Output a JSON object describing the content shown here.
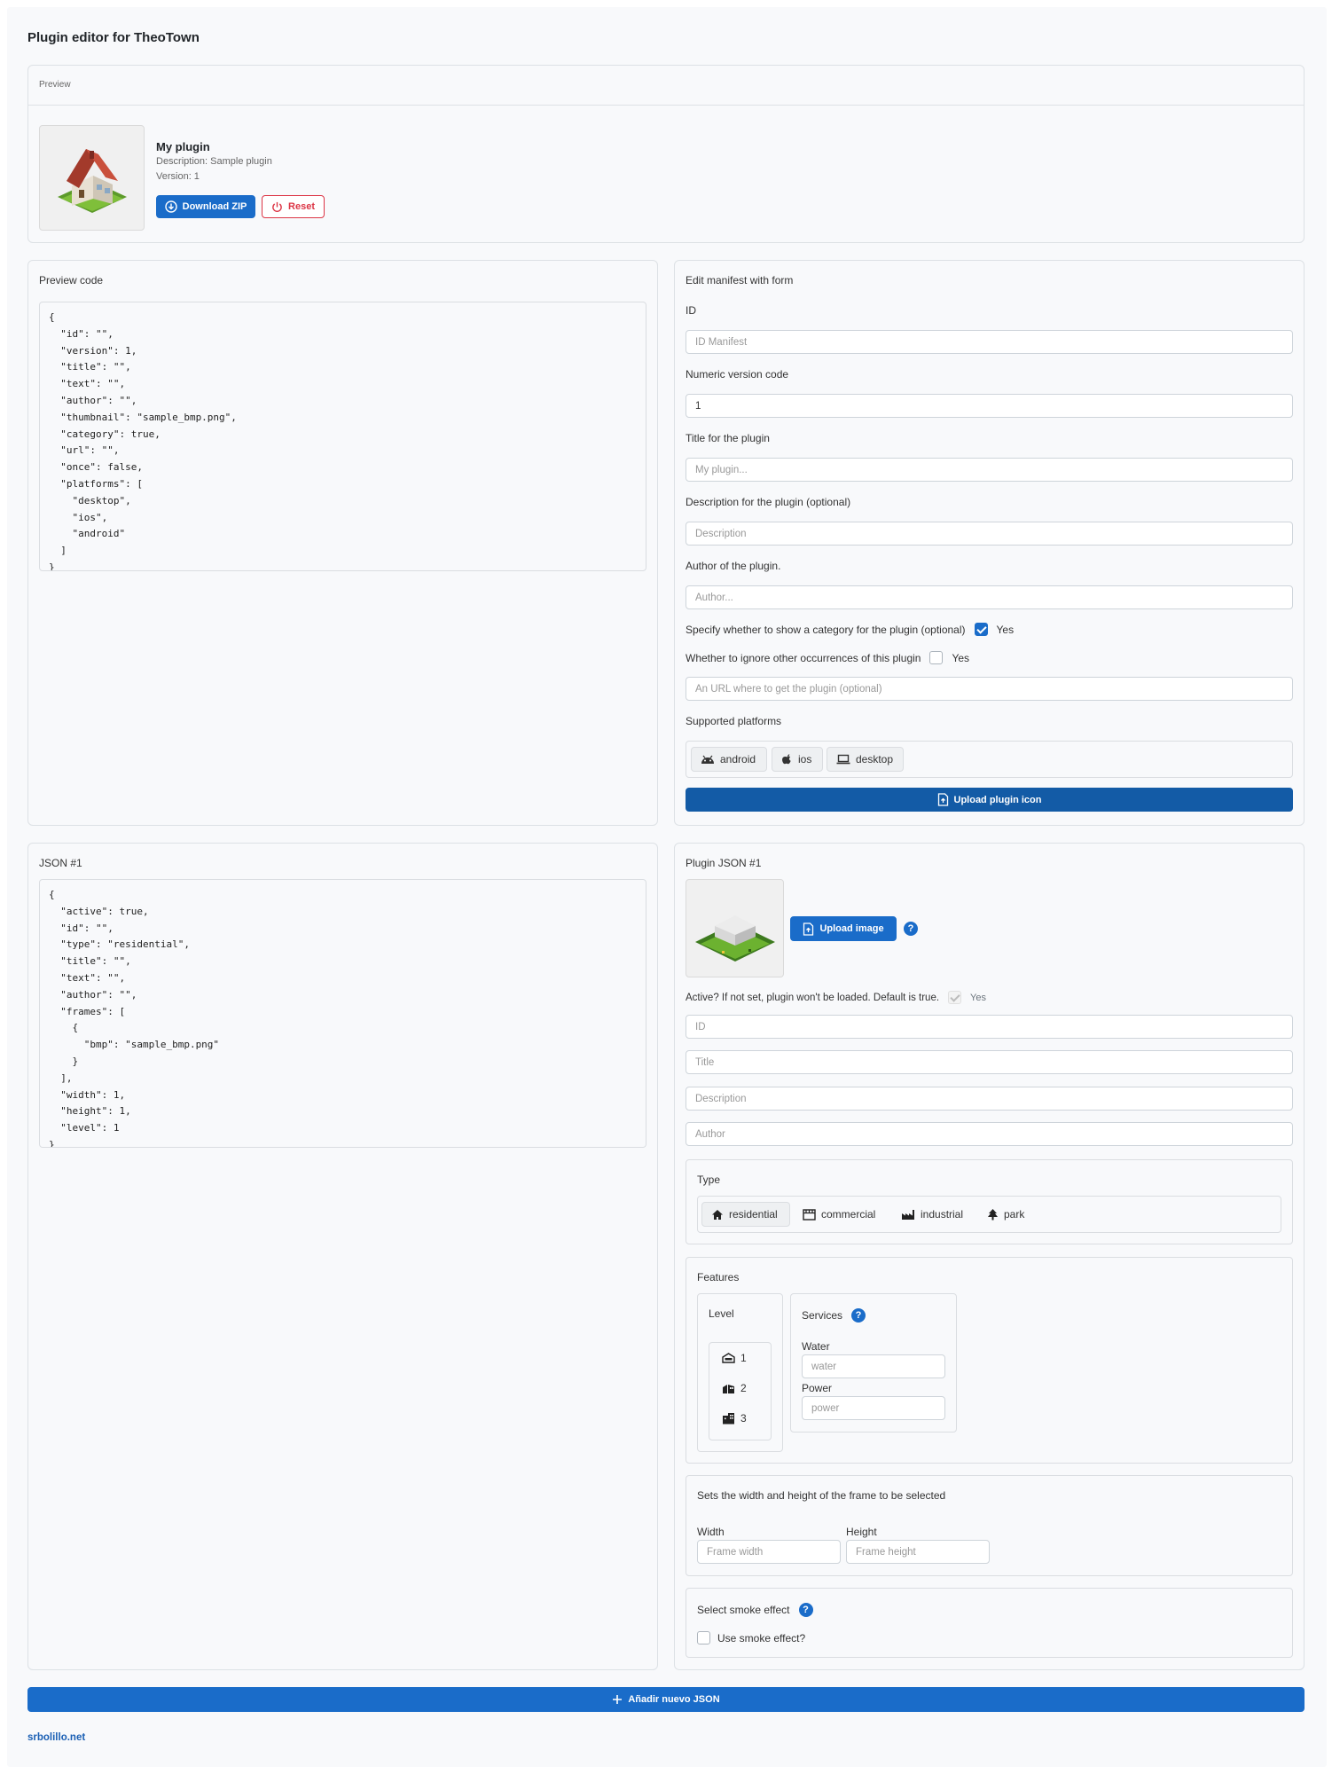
{
  "app": {
    "title": "Plugin editor for TheoTown",
    "footer": "srbolillo.net"
  },
  "preview": {
    "heading": "Preview",
    "plugin_title": "My plugin",
    "description": "Description: Sample plugin",
    "version": "Version: 1",
    "download_label": "Download ZIP",
    "reset_label": "Reset"
  },
  "preview_code": {
    "heading": "Preview code",
    "code": "{\n  \"id\": \"\",\n  \"version\": 1,\n  \"title\": \"\",\n  \"text\": \"\",\n  \"author\": \"\",\n  \"thumbnail\": \"sample_bmp.png\",\n  \"category\": true,\n  \"url\": \"\",\n  \"once\": false,\n  \"platforms\": [\n    \"desktop\",\n    \"ios\",\n    \"android\"\n  ]\n}"
  },
  "manifest_form": {
    "heading": "Edit manifest with form",
    "id_label": "ID",
    "id_placeholder": "ID Manifest",
    "version_label": "Numeric version code",
    "version_value": "1",
    "title_label": "Title for the plugin",
    "title_placeholder": "My plugin...",
    "desc_label": "Description for the plugin (optional)",
    "desc_placeholder": "Description",
    "author_label": "Author of the plugin.",
    "author_placeholder": "Author...",
    "category_label": "Specify whether to show a category for the plugin (optional)",
    "category_yes": "Yes",
    "category_checked": true,
    "once_label": "Whether to ignore other occurrences of this plugin",
    "once_yes": "Yes",
    "once_checked": false,
    "url_placeholder": "An URL where to get the plugin (optional)",
    "platforms_label": "Supported platforms",
    "platforms": [
      "android",
      "ios",
      "desktop"
    ],
    "upload_icon_label": "Upload plugin icon"
  },
  "json1": {
    "heading": "JSON #1",
    "code": "{\n  \"active\": true,\n  \"id\": \"\",\n  \"type\": \"residential\",\n  \"title\": \"\",\n  \"text\": \"\",\n  \"author\": \"\",\n  \"frames\": [\n    {\n      \"bmp\": \"sample_bmp.png\"\n    }\n  ],\n  \"width\": 1,\n  \"height\": 1,\n  \"level\": 1\n}"
  },
  "plugin_json": {
    "heading": "Plugin JSON #1",
    "upload_image_label": "Upload image",
    "help_glyph": "?",
    "active_label": "Active? If not set, plugin won't be loaded. Default is true.",
    "active_yes": "Yes",
    "id_placeholder": "ID",
    "title_placeholder": "Title",
    "desc_placeholder": "Description",
    "author_placeholder": "Author",
    "type_label": "Type",
    "types": [
      "residential",
      "commercial",
      "industrial",
      "park"
    ],
    "selected_type": "residential",
    "features_label": "Features",
    "level_label": "Level",
    "levels": [
      "1",
      "2",
      "3"
    ],
    "services_label": "Services",
    "water_label": "Water",
    "water_placeholder": "water",
    "power_label": "Power",
    "power_placeholder": "power",
    "frame_label": "Sets the width and height of the frame to be selected",
    "width_label": "Width",
    "width_placeholder": "Frame width",
    "height_label": "Height",
    "height_placeholder": "Frame height",
    "smoke_label": "Select smoke effect",
    "smoke_checkbox_label": "Use smoke effect?"
  },
  "add_json_label": "Añadir nuevo JSON",
  "colors": {
    "primary": "#1a6cc9",
    "danger": "#dc3545",
    "dark_primary": "#135ba6"
  }
}
